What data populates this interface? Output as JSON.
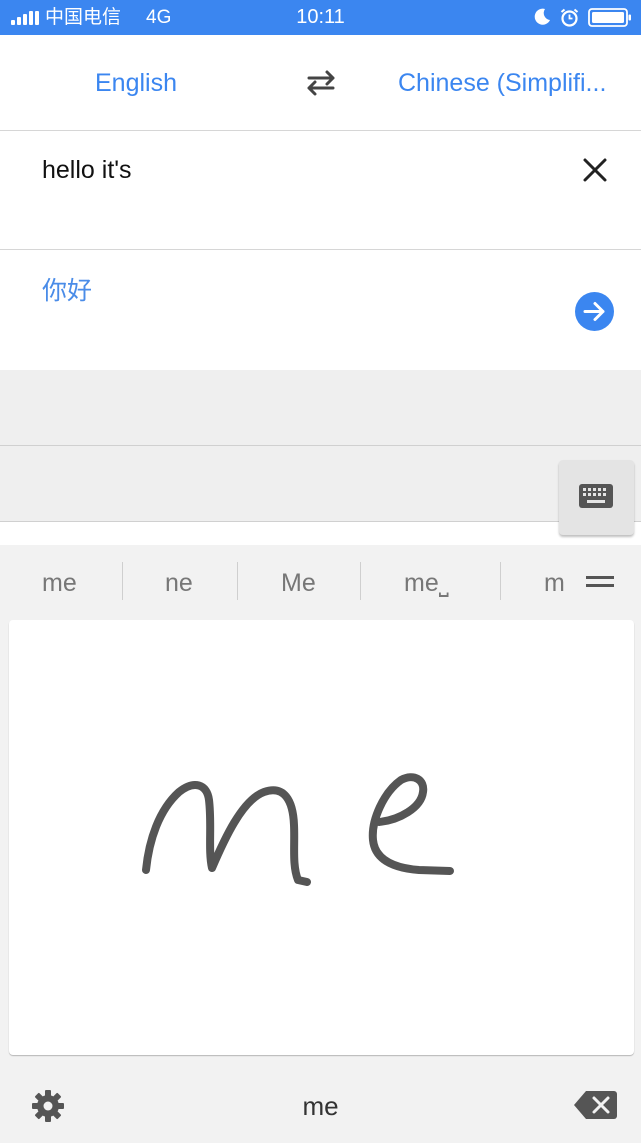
{
  "status_bar": {
    "carrier": "中国电信",
    "network": "4G",
    "time": "10:11"
  },
  "languages": {
    "source": "English",
    "target": "Chinese (Simplifi..."
  },
  "input": {
    "text": "hello it's"
  },
  "result": {
    "text": "你好"
  },
  "suggestions": [
    "me",
    "ne",
    "Me",
    "me⎵",
    "m"
  ],
  "handwriting": {
    "recognized": "me"
  },
  "colors": {
    "accent": "#3b86f0",
    "result_text": "#4a8ce8",
    "ink": "#555555"
  },
  "icons": {
    "swap": "swap-arrows-icon",
    "clear": "close-icon",
    "translate": "arrow-right-circle-icon",
    "keyboard": "keyboard-icon",
    "more": "menu-lines-icon",
    "settings": "gear-icon",
    "backspace": "backspace-icon"
  }
}
